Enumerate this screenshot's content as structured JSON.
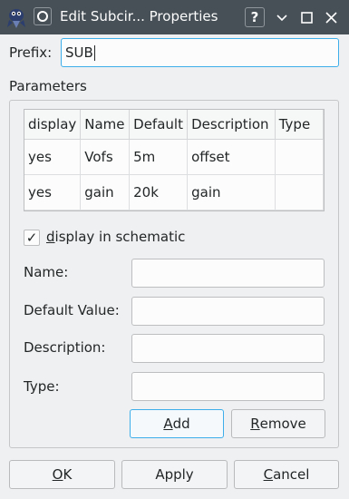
{
  "window": {
    "title": "Edit Subcir... Properties",
    "help_glyph": "?",
    "minimize_glyph": "_",
    "maximize_glyph": "□",
    "close_glyph": "✕"
  },
  "prefix": {
    "label": "Prefix:",
    "value": "SUB"
  },
  "parameters": {
    "group_title": "Parameters",
    "columns": [
      "display",
      "Name",
      "Default",
      "Description",
      "Type"
    ],
    "rows": [
      [
        "yes",
        "Vofs",
        "5m",
        "offset",
        ""
      ],
      [
        "yes",
        "gain",
        "20k",
        "gain",
        ""
      ]
    ],
    "display_checkbox": {
      "checked": true,
      "mark": "✓",
      "label_first": "d",
      "label_rest": "isplay in schematic"
    },
    "fields": {
      "name_label": "Name:",
      "default_label": "Default Value:",
      "description_label": "Description:",
      "type_label": "Type:"
    },
    "add_first": "A",
    "add_rest": "dd",
    "remove_first": "R",
    "remove_rest": "emove"
  },
  "dialog": {
    "ok_first": "O",
    "ok_rest": "K",
    "apply_label": "Apply",
    "cancel_first": "C",
    "cancel_rest": "ancel"
  }
}
